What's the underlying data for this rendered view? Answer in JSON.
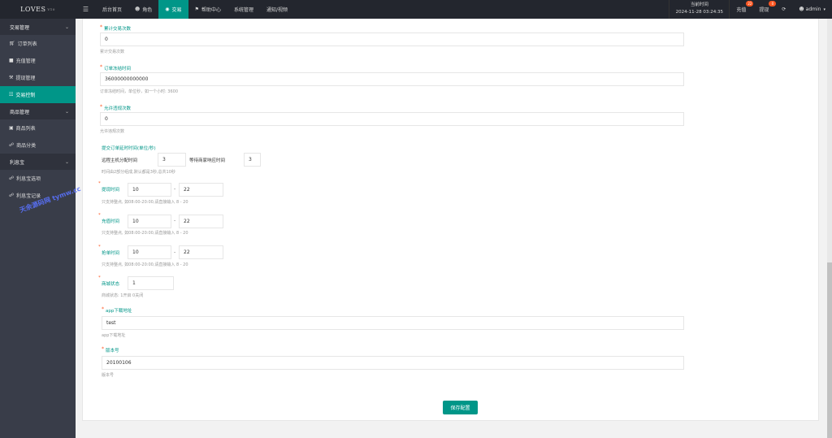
{
  "topbar": {
    "logo": "LOVES",
    "logo_sup": "V10",
    "menu_toggle_glyph": "☰",
    "nav": [
      {
        "label": "后台首页",
        "icon": "",
        "active": false
      },
      {
        "label": "角色",
        "icon": "user-icon",
        "active": false
      },
      {
        "label": "交易",
        "icon": "globe-icon",
        "active": true
      },
      {
        "label": "帮助中心",
        "icon": "flag-icon",
        "active": false
      },
      {
        "label": "系统管理",
        "icon": "",
        "active": false
      },
      {
        "label": "通知/视频",
        "icon": "",
        "active": false
      }
    ],
    "time_label": "当前时间",
    "time_value": "2024-11-28 03:24:35",
    "recharge": {
      "label": "充值",
      "badge": "22"
    },
    "withdraw": {
      "label": "提现",
      "badge": "0"
    },
    "admin": "admin"
  },
  "sidebar": {
    "groups": [
      {
        "label": "交易管理",
        "items": [
          {
            "label": "订单列表",
            "icon": "cart-icon",
            "active": false
          },
          {
            "label": "充值管理",
            "icon": "chat-icon",
            "active": false
          },
          {
            "label": "提现管理",
            "icon": "hammer-icon",
            "active": false
          },
          {
            "label": "交易控制",
            "icon": "control-icon",
            "active": true
          }
        ]
      },
      {
        "label": "商品管理",
        "items": [
          {
            "label": "商品列表",
            "icon": "cart-icon",
            "active": false
          },
          {
            "label": "商品分类",
            "icon": "link-icon",
            "active": false
          }
        ]
      },
      {
        "label": "利息宝",
        "items": [
          {
            "label": "利息宝选项",
            "icon": "link-icon",
            "active": false
          },
          {
            "label": "利息宝记录",
            "icon": "link-icon",
            "active": false
          }
        ]
      }
    ],
    "watermark": "天余源码网 tymw.cc"
  },
  "form": {
    "f1": {
      "label": "累计交易次数",
      "value": "0",
      "help": "累计交易次数"
    },
    "f2": {
      "label": "订单冻结时间",
      "value": "36000000000000",
      "help": "订单冻结时间，单位秒，如一个小时: 3600"
    },
    "f3": {
      "label": "允许违规次数",
      "value": "0",
      "help": "允许违规次数"
    },
    "f4": {
      "label": "提交订单延时时间(单位/秒)",
      "sub1_label": "远程主机分配时间",
      "sub1_value": "3",
      "sub2_label": "等待商家响应时间",
      "sub2_value": "3",
      "help": "时间由2部分组成,默认都是3秒,总共10秒"
    },
    "f5": {
      "label": "提现时间",
      "start": "10",
      "end": "22",
      "help": "只支持整点, 如08:00-20:00,请直接输入 8 - 20"
    },
    "f6": {
      "label": "充值时间",
      "start": "10",
      "end": "22",
      "help": "只支持整点, 如08:00-20:00,请直接输入 8 - 20"
    },
    "f7": {
      "label": "抢单时间",
      "start": "10",
      "end": "22",
      "help": "只支持整点, 如08:00-20:00,请直接输入 8 - 20"
    },
    "f8": {
      "label": "商城状态",
      "value": "1",
      "help": "商城状态: 1开启 0关闭"
    },
    "f9": {
      "label": "app下载地址",
      "value": "test",
      "help": "app下载地址"
    },
    "f10": {
      "label": "版本号",
      "value": "20100106",
      "help": "版本号"
    },
    "dash": "-",
    "save_label": "保存配置"
  }
}
